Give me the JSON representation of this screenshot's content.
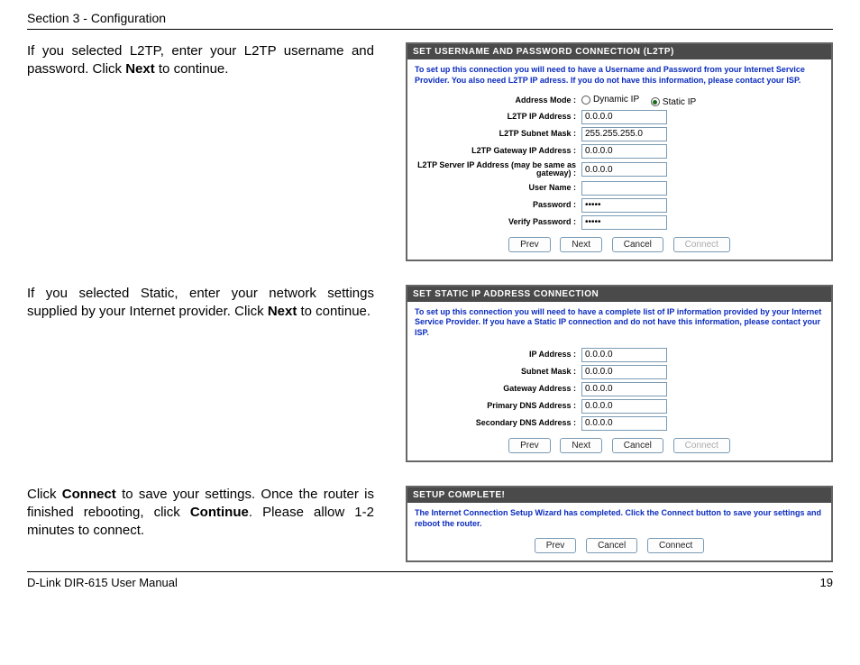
{
  "header": {
    "section": "Section 3 - Configuration"
  },
  "instr": {
    "l2tp_a": "If you selected L2TP, enter your L2TP username and password. Click ",
    "l2tp_b": "Next",
    "l2tp_c": " to continue.",
    "static_a": "If you selected Static, enter your network settings supplied by your Internet provider. Click ",
    "static_b": "Next",
    "static_c": " to continue.",
    "done_a": "Click ",
    "done_b": "Connect",
    "done_c": " to save your settings. Once the router is finished rebooting, click ",
    "done_d": "Continue",
    "done_e": ". Please allow 1-2 minutes to connect."
  },
  "l2tp": {
    "title": "SET USERNAME AND PASSWORD CONNECTION (L2TP)",
    "intro": "To set up this connection you will need to have a Username and Password from your Internet Service Provider. You also need L2TP IP adress. If you do not have this information, please contact your ISP.",
    "addrmode_label": "Address Mode :",
    "radio_dyn": "Dynamic IP",
    "radio_stat": "Static IP",
    "ip_label": "L2TP IP Address :",
    "ip_val": "0.0.0.0",
    "mask_label": "L2TP Subnet Mask :",
    "mask_val": "255.255.255.0",
    "gw_label": "L2TP Gateway IP Address :",
    "gw_val": "0.0.0.0",
    "srv_label": "L2TP Server IP Address (may be same as gateway) :",
    "srv_val": "0.0.0.0",
    "user_label": "User Name :",
    "user_val": "",
    "pw_label": "Password :",
    "pw_val": "•••••",
    "vpw_label": "Verify Password :",
    "vpw_val": "•••••",
    "btn_prev": "Prev",
    "btn_next": "Next",
    "btn_cancel": "Cancel",
    "btn_connect": "Connect"
  },
  "staticp": {
    "title": "SET STATIC IP ADDRESS CONNECTION",
    "intro": "To set up this connection you will need to have a complete list of IP information provided by your Internet Service Provider. If you have a Static IP connection and do not have this information, please contact your ISP.",
    "ip_label": "IP Address :",
    "ip_val": "0.0.0.0",
    "mask_label": "Subnet Mask :",
    "mask_val": "0.0.0.0",
    "gw_label": "Gateway Address :",
    "gw_val": "0.0.0.0",
    "dns1_label": "Primary DNS Address :",
    "dns1_val": "0.0.0.0",
    "dns2_label": "Secondary DNS Address :",
    "dns2_val": "0.0.0.0",
    "btn_prev": "Prev",
    "btn_next": "Next",
    "btn_cancel": "Cancel",
    "btn_connect": "Connect"
  },
  "done": {
    "title": "SETUP COMPLETE!",
    "intro": "The Internet Connection Setup Wizard has completed. Click the Connect button to save your settings and reboot the router.",
    "btn_prev": "Prev",
    "btn_cancel": "Cancel",
    "btn_connect": "Connect"
  },
  "footer": {
    "left": "D-Link DIR-615 User Manual",
    "right": "19"
  }
}
